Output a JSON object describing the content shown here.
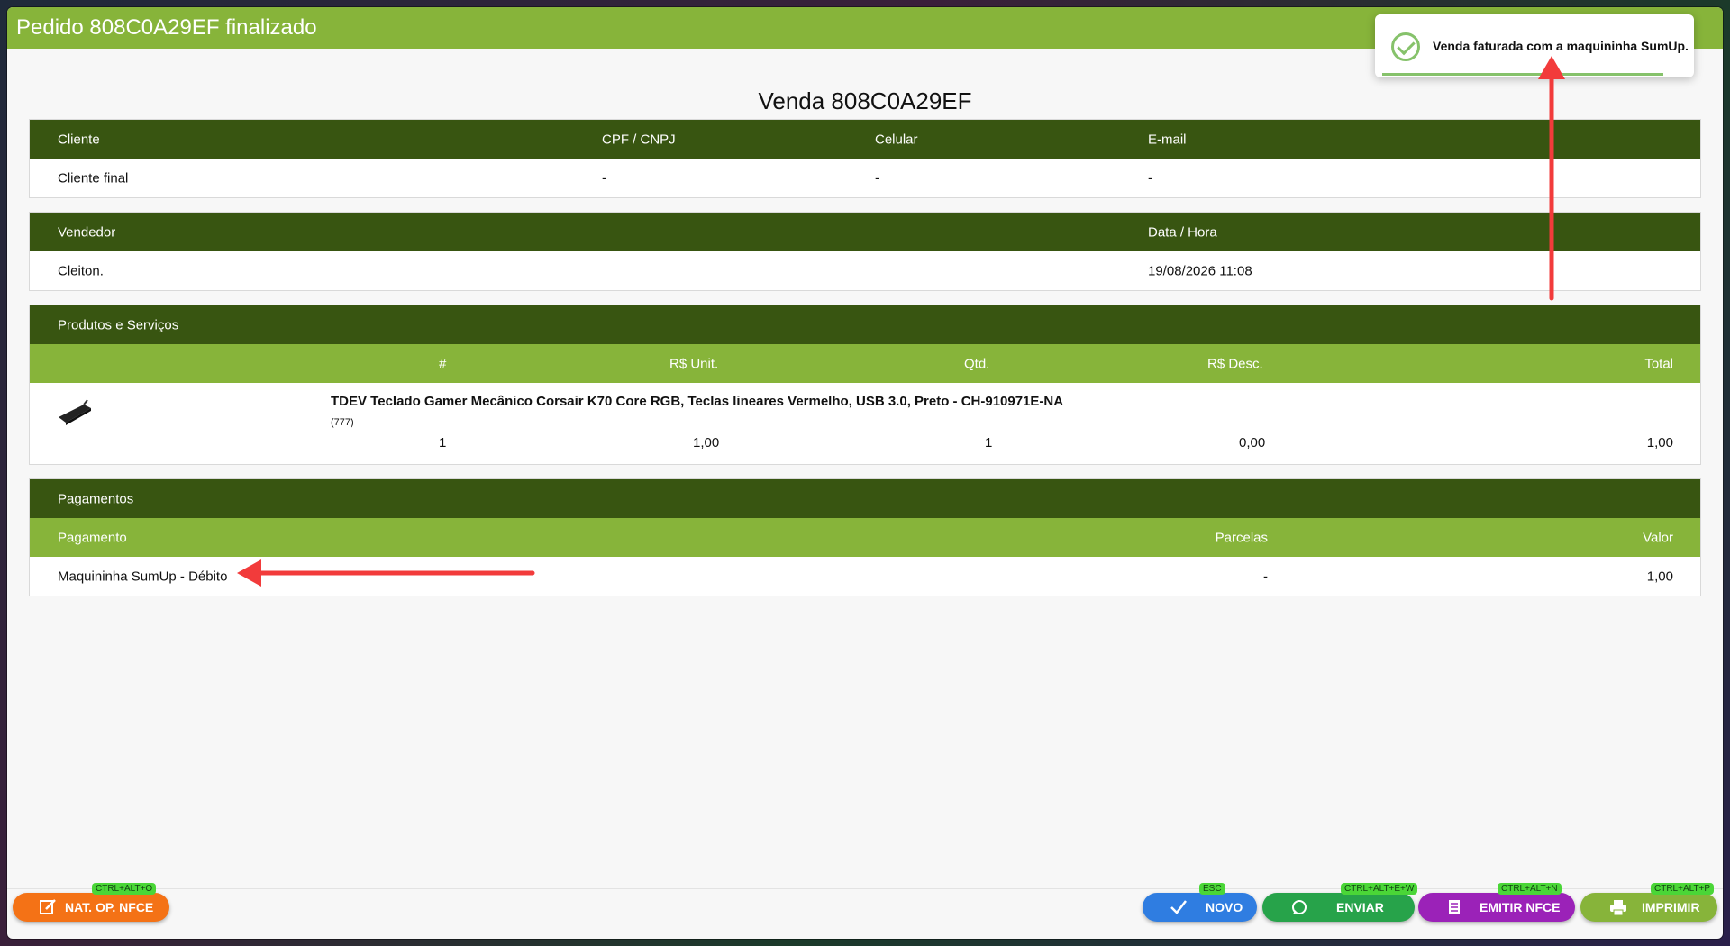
{
  "window": {
    "title": "Pedido 808C0A29EF finalizado"
  },
  "sale_title": "Venda 808C0A29EF",
  "toast": {
    "message": "Venda faturada com a maquininha SumUp."
  },
  "client": {
    "headers": [
      "Cliente",
      "CPF / CNPJ",
      "Celular",
      "E-mail"
    ],
    "values": [
      "Cliente final",
      "-",
      "-",
      "-"
    ]
  },
  "seller": {
    "headers": [
      "Vendedor",
      "Data / Hora"
    ],
    "values": [
      "Cleiton.",
      "19/08/2026 11:08"
    ]
  },
  "products": {
    "section_title": "Produtos e Serviços",
    "columns": [
      "#",
      "R$ Unit.",
      "Qtd.",
      "R$ Desc.",
      "Total"
    ],
    "items": [
      {
        "name": "TDEV Teclado Gamer Mecânico Corsair K70 Core RGB, Teclas lineares Vermelho, USB 3.0, Preto - CH-910971E-NA",
        "code": "(777)",
        "index": "1",
        "unit": "1,00",
        "qty": "1",
        "discount": "0,00",
        "total": "1,00"
      }
    ]
  },
  "payments": {
    "section_title": "Pagamentos",
    "columns": [
      "Pagamento",
      "Parcelas",
      "Valor"
    ],
    "items": [
      {
        "method": "Maquininha SumUp - Débito",
        "installments": "-",
        "value": "1,00"
      }
    ]
  },
  "buttons": {
    "nat_op": {
      "label": "NAT. OP. NFCE",
      "shortcut": "CTRL+ALT+O",
      "color": "#f47216",
      "icon": "edit-icon"
    },
    "novo": {
      "label": "NOVO",
      "shortcut": "ESC",
      "color": "#2f7de1",
      "icon": "check-icon"
    },
    "enviar": {
      "label": "ENVIAR",
      "shortcut": "CTRL+ALT+E+W",
      "color": "#27a34a",
      "icon": "whatsapp-icon"
    },
    "emitir": {
      "label": "EMITIR NFCE",
      "shortcut": "CTRL+ALT+N",
      "color": "#9b22b8",
      "icon": "receipt-icon"
    },
    "imprimir": {
      "label": "IMPRIMIR",
      "shortcut": "CTRL+ALT+P",
      "color": "#87b43a",
      "icon": "printer-icon"
    }
  },
  "colors": {
    "header_dark": "#385511",
    "header_light": "#87b43a",
    "annotation": "#f23b3b"
  }
}
